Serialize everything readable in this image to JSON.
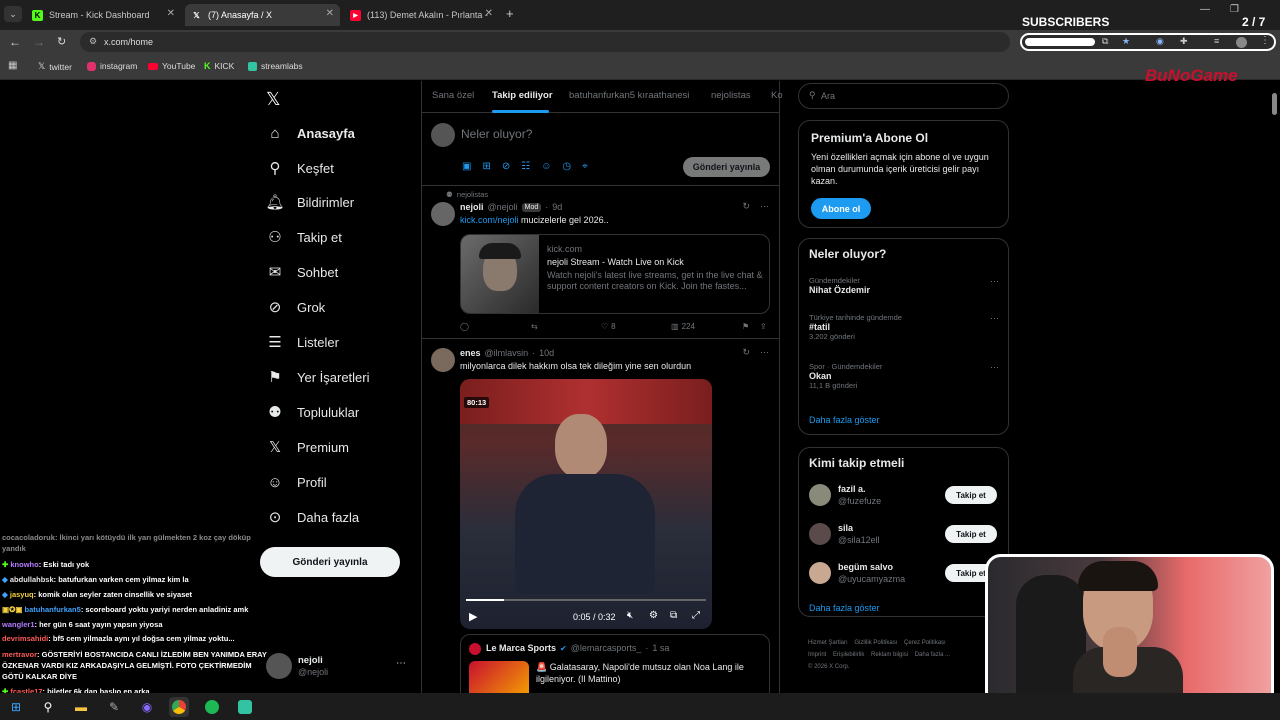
{
  "browser": {
    "tabs": [
      {
        "title": "Stream - Kick Dashboard",
        "icon": "kick-icon"
      },
      {
        "title": "(7) Anasayfa / X",
        "icon": "x-icon"
      },
      {
        "title": "(113) Demet Akalın - Pırlanta -",
        "icon": "youtube-icon"
      }
    ],
    "url": "x.com/home",
    "bookmarks": [
      "twitter",
      "instagram",
      "YouTube",
      "KICK",
      "streamlabs"
    ]
  },
  "overlay": {
    "subscribers_label": "SUBSCRIBERS",
    "subscribers_count": "2 / 7",
    "brand": "BuNoGame"
  },
  "nav": {
    "items": [
      {
        "label": "Anasayfa",
        "icon": "home-icon"
      },
      {
        "label": "Keşfet",
        "icon": "search-icon"
      },
      {
        "label": "Bildirimler",
        "icon": "bell-icon"
      },
      {
        "label": "Takip et",
        "icon": "follow-icon"
      },
      {
        "label": "Sohbet",
        "icon": "mail-icon"
      },
      {
        "label": "Grok",
        "icon": "grok-icon"
      },
      {
        "label": "Listeler",
        "icon": "list-icon"
      },
      {
        "label": "Yer İşaretleri",
        "icon": "bookmark-icon"
      },
      {
        "label": "Topluluklar",
        "icon": "communities-icon"
      },
      {
        "label": "Premium",
        "icon": "x-icon"
      },
      {
        "label": "Profil",
        "icon": "profile-icon"
      },
      {
        "label": "Daha fazla",
        "icon": "more-icon"
      }
    ],
    "post_button": "Gönderi yayınla",
    "account_name": "nejoli",
    "account_handle": "@nejoli"
  },
  "feed": {
    "tabs": [
      "Sana özel",
      "Takip ediliyor",
      "batuhanfurkan5 kıraathanesi",
      "nejolistas",
      "Ko"
    ],
    "composer_placeholder": "Neler oluyor?",
    "composer_button": "Gönderi yayınla",
    "tweet1": {
      "context": "nejolistas",
      "name": "nejoli",
      "handle": "@nejoli",
      "badge": "Mod",
      "time": "9d",
      "link": "kick.com/nejoli",
      "text": " mucizelerle gel 2026..",
      "card_domain": "kick.com",
      "card_title": "nejoli Stream - Watch Live on Kick",
      "card_desc": "Watch nejoli's latest live streams, get in the live chat & support content creators on Kick. Join the fastes...",
      "likes": "8",
      "views": "224"
    },
    "tweet2": {
      "name": "enes",
      "handle": "@ilmlavsin",
      "time": "10d",
      "text": "milyonlarca dilek hakkım olsa tek dileğim yine sen olurdun",
      "video_badge": "80:13",
      "video_time": "0:05 / 0:32",
      "quote_name": "Le Marca Sports",
      "quote_handle": "@lemarcasports_",
      "quote_time": "1 sa",
      "quote_text": "🚨 Galatasaray, Napoli'de mutsuz olan Noa Lang ile ilgileniyor. (Il Mattino)"
    }
  },
  "right": {
    "search_placeholder": "Ara",
    "premium_title": "Premium'a Abone Ol",
    "premium_text": "Yeni özellikleri açmak için abone ol ve uygun olman durumunda içerik üreticisi gelir payı kazan.",
    "premium_button": "Abone ol",
    "trends_title": "Neler oluyor?",
    "trends": [
      {
        "category": "Gündemdekiler",
        "name": "Nihat Özdemir",
        "count": ""
      },
      {
        "category": "Türkiye tarihinde gündemde",
        "name": "#tatil",
        "count": "3.202 gönderi"
      },
      {
        "category": "Spor · Gündemdekiler",
        "name": "Okan",
        "count": "11,1 B gönderi"
      }
    ],
    "show_more": "Daha fazla göster",
    "who_title": "Kimi takip etmeli",
    "who": [
      {
        "name": "fazil a.",
        "handle": "@fuzefuze"
      },
      {
        "name": "sila",
        "handle": "@sila12ell"
      },
      {
        "name": "begüm salvo",
        "handle": "@uyucamyazma"
      }
    ],
    "follow_label": "Takip et",
    "who_show_more": "Daha fazla göster",
    "footer": [
      "Hizmet Şartları",
      "Gizlilik Politikası",
      "Çerez Politikası",
      "Imprint",
      "Erişilebilirlik",
      "Reklam bilgisi",
      "Daha fazla ...",
      "© 2026 X Corp."
    ]
  },
  "chat": [
    {
      "user": "cocacoladoruk",
      "text": ": İkinci yarı kötüydü ilk yarı gülmekten 2 koz çay döküp yandık",
      "color": "#8a8a8a"
    },
    {
      "user": "knowho",
      "text": ": Eski tadı yok",
      "color": "#b57cff"
    },
    {
      "user": "abdullahbsk",
      "text": ": batufurkan varken cem yilmaz kim la",
      "color": "#e6e6e6"
    },
    {
      "user": "jasyuq",
      "text": ": komik olan seyler zaten cinsellik ve siyaset",
      "color": "#f5d142"
    },
    {
      "user": "batuhanfurkan5",
      "text": ": scoreboard yoktu yariyi nerden anladiniz amk",
      "color": "#3fa3ff"
    },
    {
      "user": "wangler1",
      "text": ": her gün 6 saat yayın yapsın yiyosa",
      "color": "#b57cff"
    },
    {
      "user": "devrimsahidi",
      "text": ": bf5 cem yilmazla aynı yıl doğsa cem yilmaz yoktu...",
      "color": "#ff5a5a"
    },
    {
      "user": "mertravor",
      "text": ": GÖSTERİYİ BOSTANCIDA CANLI İZLEDİM BEN YANIMDA ERAY ÖZKENAR VARDI KIZ ARKADAŞIYLA GELMİŞTİ. FOTO ÇEKTİRMEDİM GÖTÜ KALKAR DİYE",
      "color": "#ff5a5a"
    },
    {
      "user": "fcastle17",
      "text": ": biletler 6k dan başlıo en arka",
      "color": "#ff5a5a"
    }
  ],
  "colors": {
    "accent": "#1d9bf0",
    "kick": "#53fc18",
    "bg": "#000000"
  }
}
